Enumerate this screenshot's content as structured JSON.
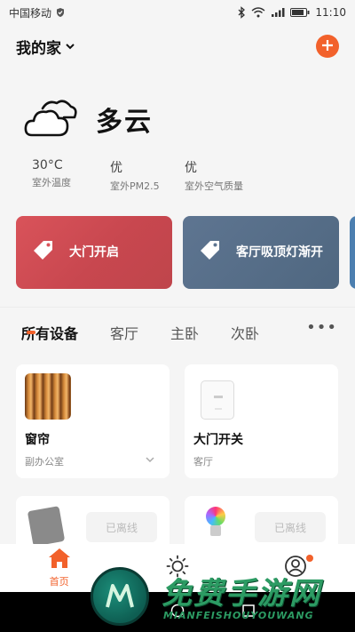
{
  "status_bar": {
    "carrier": "中国移动",
    "time": "11:10"
  },
  "header": {
    "home_name": "我的家"
  },
  "weather": {
    "condition": "多云",
    "metrics": [
      {
        "value": "30°C",
        "label": "室外温度"
      },
      {
        "value": "优",
        "label": "室外PM2.5"
      },
      {
        "value": "优",
        "label": "室外空气质量"
      }
    ]
  },
  "scenes": [
    {
      "name": "大门开启",
      "color": "#d9535a"
    },
    {
      "name": "客厅吸顶灯渐开",
      "color": "#5e7591"
    }
  ],
  "tabs": [
    {
      "label": "所有设备",
      "active": true
    },
    {
      "label": "客厅"
    },
    {
      "label": "主卧"
    },
    {
      "label": "次卧"
    }
  ],
  "devices": [
    {
      "name": "窗帘",
      "room": "副办公室",
      "icon": "curtain-thumbnail"
    },
    {
      "name": "大门开关",
      "room": "客厅",
      "icon": "switch-thumbnail"
    },
    {
      "status": "已离线",
      "icon": "sensor-thumbnail"
    },
    {
      "status": "已离线",
      "icon": "bulb-thumbnail"
    }
  ],
  "bottom_nav": {
    "home_label": "首页"
  },
  "watermark": {
    "title": "免费手游网",
    "subtitle": "MIANFEISHOUYOUWANG"
  },
  "colors": {
    "accent": "#f2612b",
    "scene_red": "#d9535a",
    "scene_blue": "#5e7591"
  }
}
